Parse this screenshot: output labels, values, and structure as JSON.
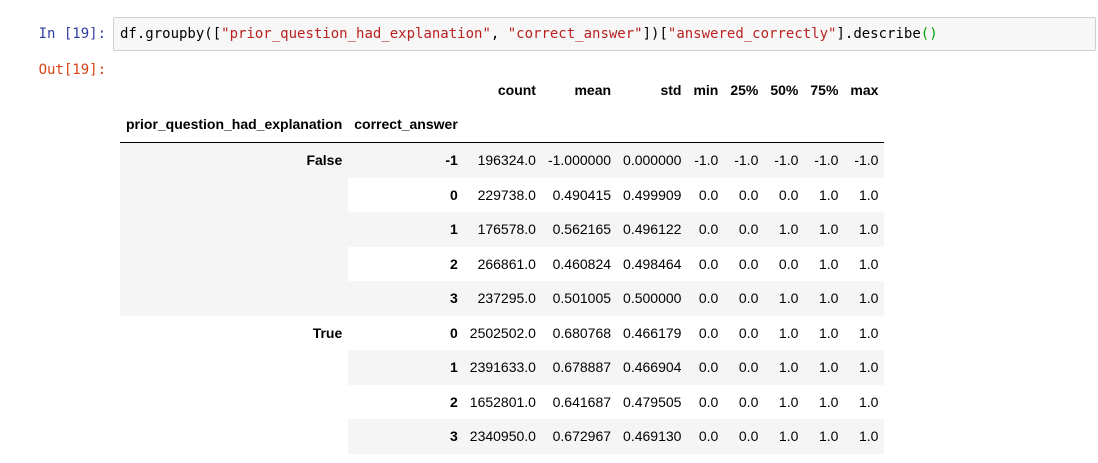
{
  "cell": {
    "in_prompt": "In [19]:",
    "out_prompt": "Out[19]:",
    "code": {
      "t1": "df.groupby(",
      "t2": "[",
      "t3": "\"prior_question_had_explanation\"",
      "t4": ", ",
      "t5": "\"correct_answer\"",
      "t6": "])[",
      "t7": "\"answered_correctly\"",
      "t8": "].describe",
      "t9": "()"
    }
  },
  "table": {
    "columns": [
      "count",
      "mean",
      "std",
      "min",
      "25%",
      "50%",
      "75%",
      "max"
    ],
    "index_names": [
      "prior_question_had_explanation",
      "correct_answer"
    ],
    "groups": [
      {
        "label": "False",
        "rows": [
          {
            "key": "-1",
            "values": [
              "196324.0",
              "-1.000000",
              "0.000000",
              "-1.0",
              "-1.0",
              "-1.0",
              "-1.0",
              "-1.0"
            ]
          },
          {
            "key": "0",
            "values": [
              "229738.0",
              "0.490415",
              "0.499909",
              "0.0",
              "0.0",
              "0.0",
              "1.0",
              "1.0"
            ]
          },
          {
            "key": "1",
            "values": [
              "176578.0",
              "0.562165",
              "0.496122",
              "0.0",
              "0.0",
              "1.0",
              "1.0",
              "1.0"
            ]
          },
          {
            "key": "2",
            "values": [
              "266861.0",
              "0.460824",
              "0.498464",
              "0.0",
              "0.0",
              "0.0",
              "1.0",
              "1.0"
            ]
          },
          {
            "key": "3",
            "values": [
              "237295.0",
              "0.501005",
              "0.500000",
              "0.0",
              "0.0",
              "1.0",
              "1.0",
              "1.0"
            ]
          }
        ]
      },
      {
        "label": "True",
        "rows": [
          {
            "key": "0",
            "values": [
              "2502502.0",
              "0.680768",
              "0.466179",
              "0.0",
              "0.0",
              "1.0",
              "1.0",
              "1.0"
            ]
          },
          {
            "key": "1",
            "values": [
              "2391633.0",
              "0.678887",
              "0.466904",
              "0.0",
              "0.0",
              "1.0",
              "1.0",
              "1.0"
            ]
          },
          {
            "key": "2",
            "values": [
              "1652801.0",
              "0.641687",
              "0.479505",
              "0.0",
              "0.0",
              "1.0",
              "1.0",
              "1.0"
            ]
          },
          {
            "key": "3",
            "values": [
              "2340950.0",
              "0.672967",
              "0.469130",
              "0.0",
              "0.0",
              "1.0",
              "1.0",
              "1.0"
            ]
          }
        ]
      }
    ]
  }
}
